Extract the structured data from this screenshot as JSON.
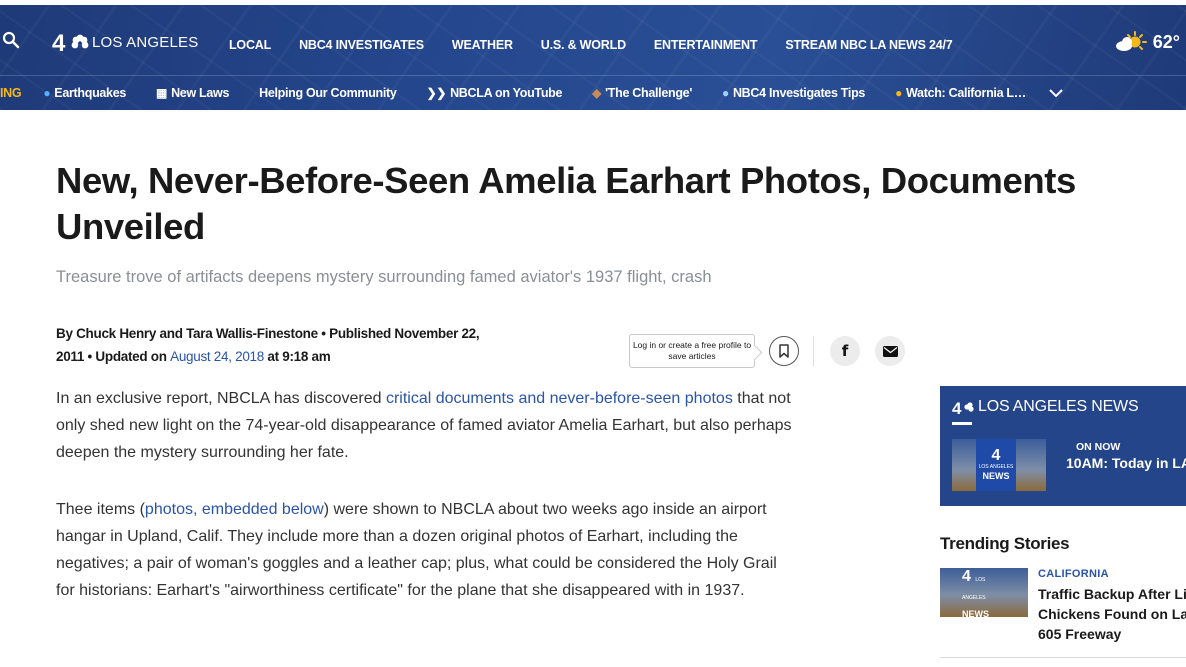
{
  "header": {
    "logo_text": "LOS ANGELES",
    "nav": [
      "LOCAL",
      "NBC4 INVESTIGATES",
      "WEATHER",
      "U.S. & WORLD",
      "ENTERTAINMENT",
      "STREAM NBC LA NEWS 24/7"
    ],
    "weather_temp": "62°",
    "weather_icon": "partly-sunny-icon"
  },
  "subnav": {
    "trending_label": "ING",
    "items": [
      {
        "icon": "globe-icon",
        "label": "Earthquakes"
      },
      {
        "icon": "calendar-icon",
        "label": "New Laws"
      },
      {
        "icon": "",
        "label": "Helping Our Community"
      },
      {
        "icon": "youtube-icon",
        "label": "NBCLA on YouTube"
      },
      {
        "icon": "football-icon",
        "label": "'The Challenge'"
      },
      {
        "icon": "pin-icon",
        "label": "NBC4 Investigates Tips"
      },
      {
        "icon": "sun-icon",
        "label": "Watch: California L…"
      }
    ]
  },
  "article": {
    "headline": "New, Never-Before-Seen Amelia Earhart Photos, Documents Unveiled",
    "subhead": "Treasure trove of artifacts deepens mystery surrounding famed aviator's 1937 flight, crash",
    "byline_authors": "By Chuck Henry and Tara Wallis-Finestone",
    "byline_published": " • Published November 22, 2011",
    "byline_updated_prefix": " • Updated on ",
    "byline_updated_date": "August 24, 2018",
    "byline_updated_time": " at 9:18 am",
    "save_tip": "Log in or create a free profile to save articles",
    "facebook_label": "f",
    "p1_before": "In an exclusive report, NBCLA has discovered ",
    "p1_link": "critical documents and never-before-seen photos",
    "p1_after": " that not only shed new light on the 74-year-old disappearance of famed aviator Amelia Earhart, but also perhaps deepen the mystery surrounding her fate.",
    "p2_before": "Thee items (",
    "p2_link": "photos, embedded below",
    "p2_after": ") were shown to NBCLA about two weeks ago inside an airport hangar in Upland, Calif. They include more than a dozen original photos of Earhart, including the negatives; a pair of woman's goggles and a leather cap; plus, what could be considered the Holy Grail for historians: Earhart's \"airworthiness certificate\" for the plane that she disappeared with in 1937."
  },
  "sidebar": {
    "news_title": "LOS ANGELES NEWS",
    "badge_number": "4",
    "badge_city": "LOS ANGELES",
    "badge_news": "NEWS",
    "on_now": "ON NOW",
    "show": "10AM: Today in LA",
    "trending_title": "Trending Stories",
    "trend_category": "CALIFORNIA",
    "trend_headline_lines": [
      "Traffic Backup After Live",
      "Chickens Found on Lanes of",
      "605 Freeway"
    ]
  },
  "colors": {
    "header_bg": "#24468c",
    "trending_accent": "#f5b81c",
    "link": "#2a54a8"
  }
}
